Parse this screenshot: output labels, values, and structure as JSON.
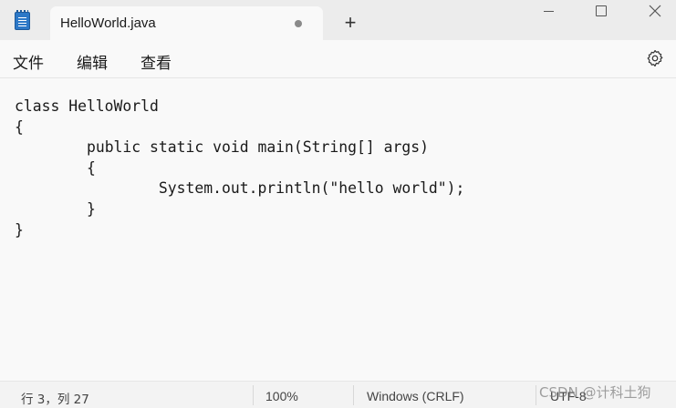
{
  "tab": {
    "title": "HelloWorld.java",
    "new_tab_label": "+"
  },
  "menu": {
    "file": "文件",
    "edit": "编辑",
    "view": "查看"
  },
  "editor": {
    "code": "class HelloWorld\n{\n\tpublic static void main(String[] args)\n\t{\n\t\tSystem.out.println(\"hello world\");\n\t}\n}"
  },
  "status": {
    "position": "行 3，列 27",
    "zoom": "100%",
    "line_ending": "Windows (CRLF)",
    "encoding": "UTF-8"
  },
  "watermark": "CSDN @计科土狗",
  "icons": {
    "app": "notepad-icon",
    "unsaved": "unsaved-dot-icon",
    "settings": "gear-icon"
  }
}
